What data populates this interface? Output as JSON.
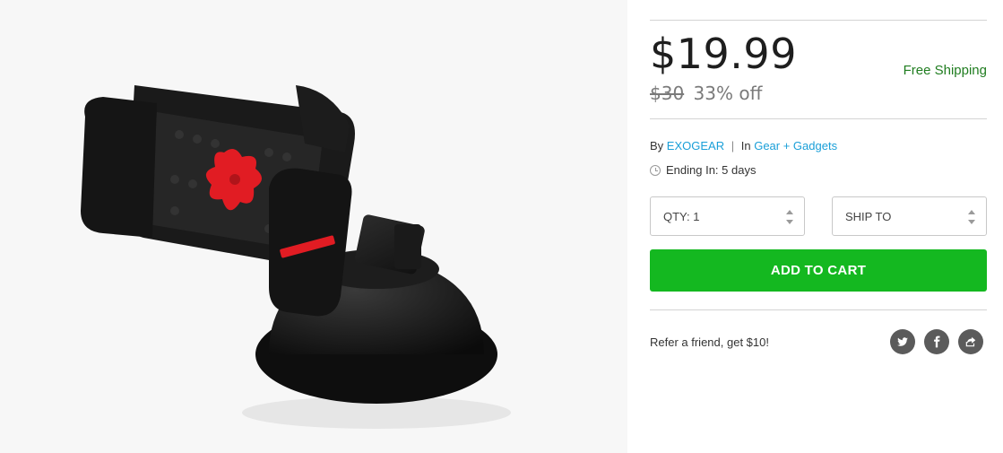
{
  "price": {
    "current": "$19.99",
    "original": "$30",
    "discount": "33% off",
    "shipping": "Free Shipping"
  },
  "vendor": {
    "by_label": "By",
    "name": "EXOGEAR",
    "separator": "|",
    "in_label": "In",
    "category": "Gear + Gadgets"
  },
  "ending": {
    "text": "Ending In: 5 days"
  },
  "options": {
    "qty_label": "QTY: 1",
    "ship_label": "SHIP TO"
  },
  "cart": {
    "button_label": "ADD TO CART"
  },
  "refer": {
    "text": "Refer a friend, get $10!"
  },
  "social": {
    "icons": [
      "twitter-icon",
      "facebook-icon",
      "share-icon"
    ]
  },
  "colors": {
    "accent_green": "#14b820",
    "shipping_green": "#207d20",
    "link_blue": "#1a9fd8",
    "icon_gray": "#5b5b5b"
  }
}
